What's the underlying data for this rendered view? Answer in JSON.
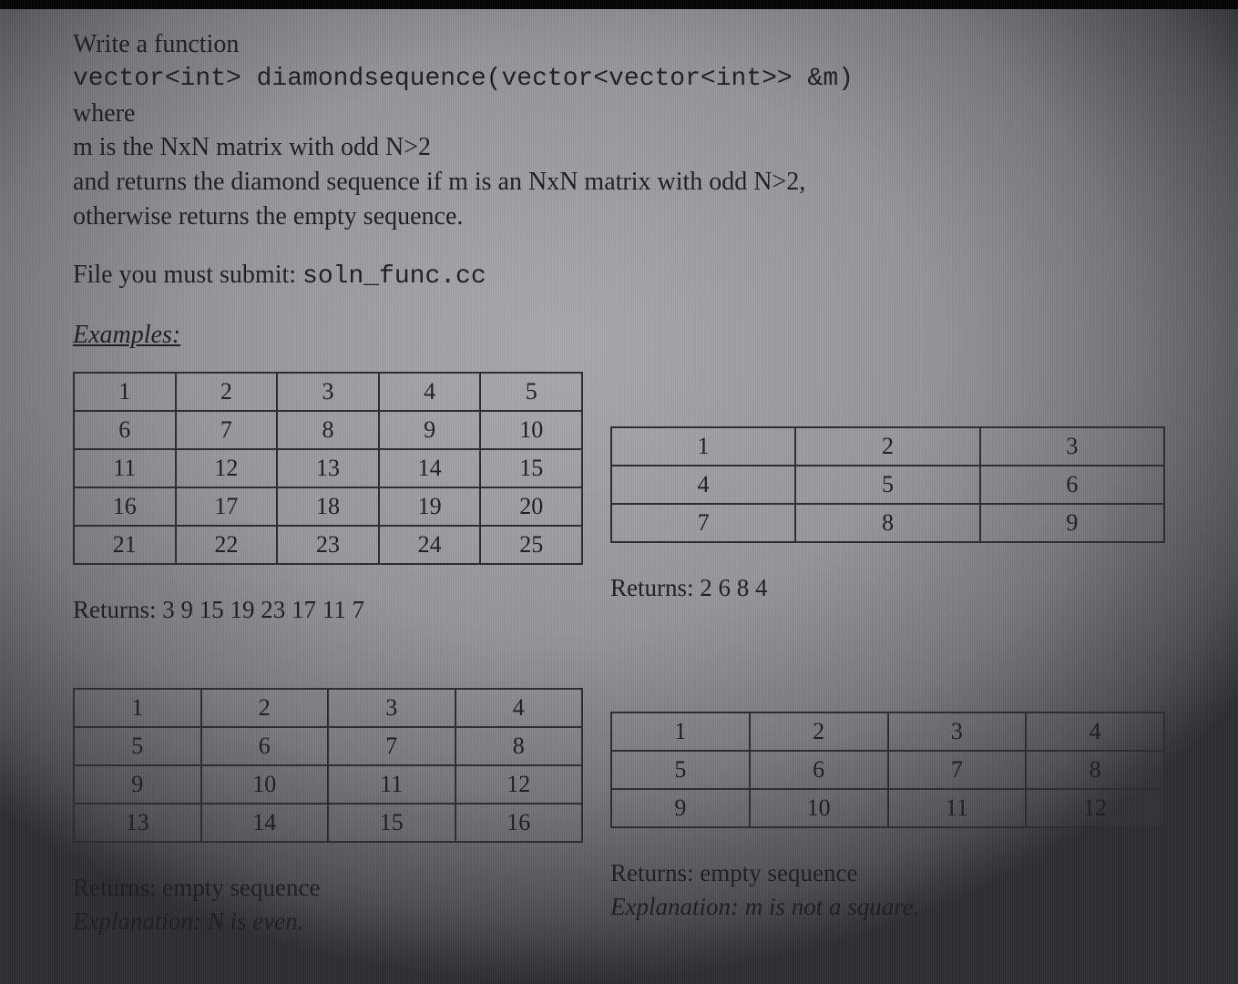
{
  "prompt": {
    "line1": "Write a function",
    "signature": "vector<int> diamondsequence(vector<vector<int>> &m)",
    "line3": "where",
    "line4": "m is the NxN matrix with odd N>2",
    "line5": "and returns the diamond sequence if m is an NxN matrix with odd N>2,",
    "line6": "otherwise returns the empty sequence.",
    "submit_prefix": "File you must submit: ",
    "submit_file": "soln_func.cc",
    "examples_heading": "Examples:"
  },
  "examples": [
    {
      "matrix": [
        [
          "1",
          "2",
          "3",
          "4",
          "5"
        ],
        [
          "6",
          "7",
          "8",
          "9",
          "10"
        ],
        [
          "11",
          "12",
          "13",
          "14",
          "15"
        ],
        [
          "16",
          "17",
          "18",
          "19",
          "20"
        ],
        [
          "21",
          "22",
          "23",
          "24",
          "25"
        ]
      ],
      "returns_label": "Returns:",
      "returns_value": "3 9 15 19 23 17 11 7"
    },
    {
      "matrix": [
        [
          "1",
          "2",
          "3"
        ],
        [
          "4",
          "5",
          "6"
        ],
        [
          "7",
          "8",
          "9"
        ]
      ],
      "returns_label": "Returns:",
      "returns_value": "2 6 8 4"
    },
    {
      "matrix": [
        [
          "1",
          "2",
          "3",
          "4"
        ],
        [
          "5",
          "6",
          "7",
          "8"
        ],
        [
          "9",
          "10",
          "11",
          "12"
        ],
        [
          "13",
          "14",
          "15",
          "16"
        ]
      ],
      "returns_label": "Returns:",
      "returns_value": "empty sequence",
      "explanation_label": "Explanation:",
      "explanation_body": "N is even."
    },
    {
      "matrix": [
        [
          "1",
          "2",
          "3",
          "4"
        ],
        [
          "5",
          "6",
          "7",
          "8"
        ],
        [
          "9",
          "10",
          "11",
          "12"
        ]
      ],
      "returns_label": "Returns:",
      "returns_value": "empty sequence",
      "explanation_label": "Explanation:",
      "explanation_body": "m is not a square."
    }
  ]
}
